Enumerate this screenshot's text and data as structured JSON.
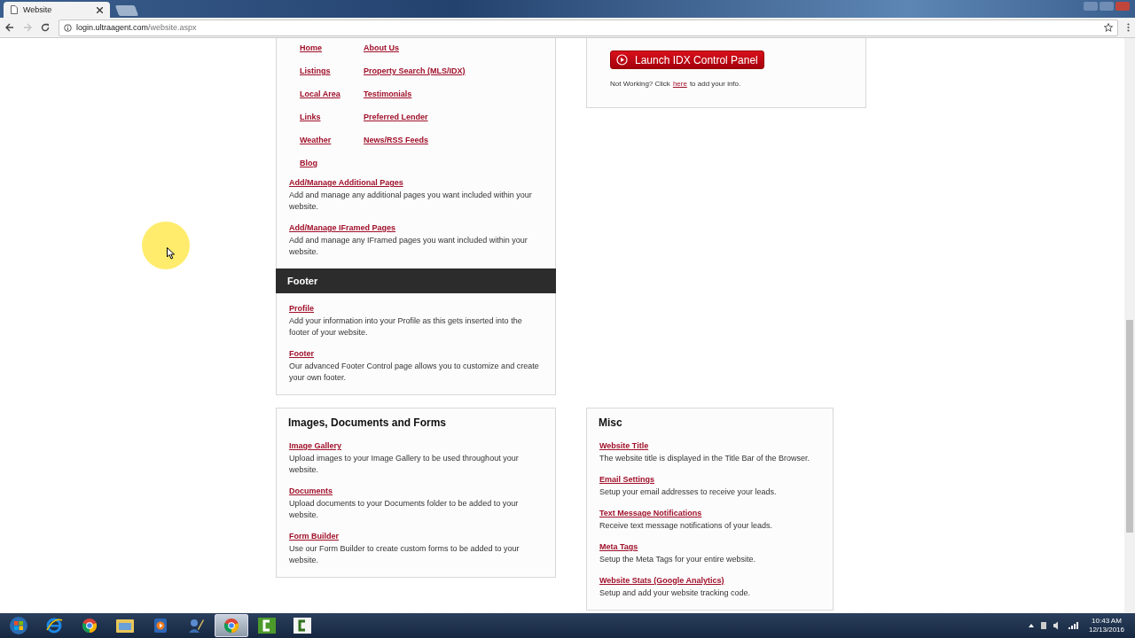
{
  "browser": {
    "tab_title": "Website",
    "url_domain": "login.ultraagent.com",
    "url_path": "/website.aspx",
    "forward_disabled": true
  },
  "pages_card": {
    "nav_links": [
      "Home",
      "About Us",
      "Listings",
      "Property Search (MLS/IDX)",
      "Local Area",
      "Testimonials",
      "Links",
      "Preferred Lender",
      "Weather",
      "News/RSS Feeds",
      "Blog"
    ],
    "items": [
      {
        "link": "Add/Manage Additional Pages",
        "text": "Add and manage any additional pages you want included within your website."
      },
      {
        "link": "Add/Manage IFramed Pages",
        "text": "Add and manage any IFramed pages you want included within your website."
      }
    ],
    "footer_title": "Footer",
    "footer_items": [
      {
        "link": "Profile",
        "text": "Add your information into your Profile as this gets inserted into the footer of your website."
      },
      {
        "link": "Footer",
        "text": "Our advanced Footer Control page allows you to customize and create your own footer."
      }
    ]
  },
  "idx_card": {
    "button": "Launch IDX Control Panel",
    "note_before": "Not Working? Click",
    "note_link": "here",
    "note_after": "to add your info."
  },
  "images_card": {
    "title": "Images, Documents and Forms",
    "items": [
      {
        "link": "Image Gallery",
        "text": "Upload images to your Image Gallery to be used throughout your website."
      },
      {
        "link": "Documents",
        "text": "Upload documents to your Documents folder to be added to your website."
      },
      {
        "link": "Form Builder",
        "text": "Use our Form Builder to create custom forms to be added to your website."
      }
    ]
  },
  "misc_card": {
    "title": "Misc",
    "items": [
      {
        "link": "Website Title",
        "text": "The website title is displayed in the Title Bar of the Browser."
      },
      {
        "link": "Email Settings",
        "text": "Setup your email addresses to receive your leads."
      },
      {
        "link": "Text Message Notifications",
        "text": "Receive text message notifications of your leads."
      },
      {
        "link": "Meta Tags",
        "text": "Setup the Meta Tags for your entire website."
      },
      {
        "link": "Website Stats (Google Analytics)",
        "text": "Setup and add your website tracking code."
      }
    ]
  },
  "taskbar": {
    "apps": [
      {
        "kind": "start",
        "selected": false
      },
      {
        "kind": "ie",
        "selected": false
      },
      {
        "kind": "chrome",
        "selected": false
      },
      {
        "kind": "folder",
        "selected": false
      },
      {
        "kind": "media",
        "selected": false
      },
      {
        "kind": "tool",
        "selected": false
      },
      {
        "kind": "chrome",
        "selected": true
      },
      {
        "kind": "recorder",
        "selected": false
      },
      {
        "kind": "editor",
        "selected": false
      }
    ],
    "time": "10:43 AM",
    "date": "12/13/2016"
  }
}
